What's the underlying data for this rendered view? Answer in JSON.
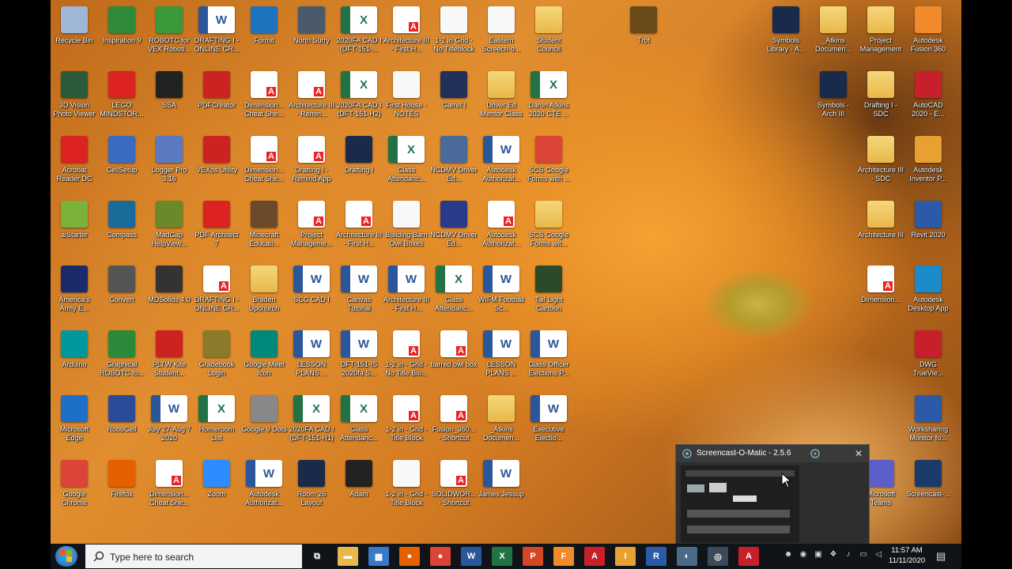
{
  "desktop_icons": [
    {
      "label": "Recycle Bin",
      "icon": "recycle-bin-icon",
      "kind": "app",
      "color": "#9fb7d6"
    },
    {
      "label": "Inspiration 9",
      "icon": "inspiration-icon",
      "kind": "app",
      "color": "#2f8a3a"
    },
    {
      "label": "ROBOTC for VEX Roboti...",
      "icon": "robotc-icon",
      "kind": "app",
      "color": "#3a9a3a"
    },
    {
      "label": "DRAFTING I - ONLINE GR...",
      "icon": "word-doc-icon",
      "kind": "word",
      "color": "#2b579a"
    },
    {
      "label": "Formit",
      "icon": "formit-icon",
      "kind": "app",
      "color": "#1e73be"
    },
    {
      "label": "North Surry",
      "icon": "school-image-icon",
      "kind": "app",
      "color": "#4a5a6a"
    },
    {
      "label": "2020FA CAD I (DFT-151-...",
      "icon": "excel-doc-icon",
      "kind": "excel",
      "color": "#217346"
    },
    {
      "label": "Architecture III - First H...",
      "icon": "pdf-doc-icon",
      "kind": "pdf",
      "color": "#e22"
    },
    {
      "label": "1-2 in Grid - No Titleblock",
      "icon": "blank-doc-icon",
      "kind": "doc",
      "color": "#fff"
    },
    {
      "label": "Eastern Screech-o...",
      "icon": "doc-icon",
      "kind": "doc",
      "color": "#fff"
    },
    {
      "label": "Student Council",
      "icon": "folder-icon",
      "kind": "folder",
      "color": "#e8b84a"
    },
    {
      "label": "Trot",
      "icon": "trot-icon",
      "kind": "app",
      "color": "#6b4a1a"
    },
    {
      "label": "3D Vision Photo Viewer",
      "icon": "3d-vision-icon",
      "kind": "app",
      "color": "#2b5a3a"
    },
    {
      "label": "LEGO MINDSTOR...",
      "icon": "lego-icon",
      "kind": "app",
      "color": "#d22"
    },
    {
      "label": "SSA",
      "icon": "ssa-icon",
      "kind": "app",
      "color": "#222"
    },
    {
      "label": "PDFCreator",
      "icon": "pdfcreator-icon",
      "kind": "app",
      "color": "#c22"
    },
    {
      "label": "Dimension... Cheat She...",
      "icon": "pdf-doc-icon",
      "kind": "pdf",
      "color": "#e22"
    },
    {
      "label": "Architecture III - Remin...",
      "icon": "pdf-doc-icon",
      "kind": "pdf",
      "color": "#e22"
    },
    {
      "label": "2020FA CAD I (DFT-151-H2)",
      "icon": "excel-doc-icon",
      "kind": "excel",
      "color": "#217346"
    },
    {
      "label": "First House - NOTES",
      "icon": "doc-icon",
      "kind": "doc",
      "color": "#fff"
    },
    {
      "label": "Garret I",
      "icon": "garret-image-icon",
      "kind": "app",
      "color": "#23305a"
    },
    {
      "label": "Driver Ed Mentor Class",
      "icon": "folder-icon",
      "kind": "folder",
      "color": "#e8b84a"
    },
    {
      "label": "Daron Atkins 2020 CTE ...",
      "icon": "excel-doc-icon",
      "kind": "excel",
      "color": "#217346"
    },
    {
      "label": "Acrobat Reader DC",
      "icon": "acrobat-icon",
      "kind": "app",
      "color": "#d22"
    },
    {
      "label": "CellSetup",
      "icon": "cellsetup-icon",
      "kind": "app",
      "color": "#3a6ac2"
    },
    {
      "label": "Logger Pro 3.16",
      "icon": "logger-pro-icon",
      "kind": "app",
      "color": "#5a7ac2"
    },
    {
      "label": "VEXos Utility",
      "icon": "vexos-icon",
      "kind": "app",
      "color": "#c22"
    },
    {
      "label": "Dimension... Cheat She...",
      "icon": "pdf-doc-icon",
      "kind": "pdf",
      "color": "#e22"
    },
    {
      "label": "Drafting I - Remind App",
      "icon": "pdf-doc-icon",
      "kind": "pdf",
      "color": "#e22"
    },
    {
      "label": "Drafting I",
      "icon": "book-icon",
      "kind": "app",
      "color": "#1a2a4a"
    },
    {
      "label": "Class Attendanc...",
      "icon": "excel-doc-icon",
      "kind": "excel",
      "color": "#217346"
    },
    {
      "label": "NCDMV Driver Ed...",
      "icon": "ncdmv-icon",
      "kind": "app",
      "color": "#4a6a9a"
    },
    {
      "label": "Autodesk Authorizat...",
      "icon": "word-doc-icon",
      "kind": "word",
      "color": "#2b579a"
    },
    {
      "label": "SCS Google Forms with ...",
      "icon": "chrome-icon",
      "kind": "app",
      "color": "#db4437"
    },
    {
      "label": "aiStarter",
      "icon": "aistarter-icon",
      "kind": "app",
      "color": "#7ab23a"
    },
    {
      "label": "Compass",
      "icon": "compass-icon",
      "kind": "app",
      "color": "#1a6a9a"
    },
    {
      "label": "MadCap HelpView...",
      "icon": "madcap-icon",
      "kind": "app",
      "color": "#6a8a2a"
    },
    {
      "label": "PDF Architect 7",
      "icon": "pdf-architect-icon",
      "kind": "app",
      "color": "#d22"
    },
    {
      "label": "Minecraft Educati...",
      "icon": "minecraft-icon",
      "kind": "app",
      "color": "#6a4a2a"
    },
    {
      "label": "Project Manageme...",
      "icon": "pdf-doc-icon",
      "kind": "pdf",
      "color": "#e22"
    },
    {
      "label": "Architecture III - First H...",
      "icon": "pdf-doc-icon",
      "kind": "pdf",
      "color": "#e22"
    },
    {
      "label": "Building Barn Owl Boxes",
      "icon": "image-doc-icon",
      "kind": "doc",
      "color": "#fff"
    },
    {
      "label": "NCDMV Driver Ed...",
      "icon": "ncdmv-icon",
      "kind": "app",
      "color": "#2a3a8a"
    },
    {
      "label": "Autodesk Authorizat...",
      "icon": "pdf-doc-icon",
      "kind": "pdf",
      "color": "#e22"
    },
    {
      "label": "SCS Google Forms wit...",
      "icon": "folder-icon",
      "kind": "folder",
      "color": "#e8b84a"
    },
    {
      "label": "America's Army E...",
      "icon": "americas-army-icon",
      "kind": "app",
      "color": "#1a2a6a"
    },
    {
      "label": "Convert",
      "icon": "convert-icon",
      "kind": "app",
      "color": "#555"
    },
    {
      "label": "MDSolids 4.0",
      "icon": "mdsolids-icon",
      "kind": "app",
      "color": "#333"
    },
    {
      "label": "DRAFTING I - ONLINE GR...",
      "icon": "pdf-doc-icon",
      "kind": "pdf",
      "color": "#e22"
    },
    {
      "label": "Braden Upchurch",
      "icon": "folder-icon",
      "kind": "folder",
      "color": "#e8b84a"
    },
    {
      "label": "SCC CAD I",
      "icon": "word-doc-icon",
      "kind": "word",
      "color": "#2b579a"
    },
    {
      "label": "Canvas Tutorial",
      "icon": "word-doc-icon",
      "kind": "word",
      "color": "#2b579a"
    },
    {
      "label": "Architecture III - First H...",
      "icon": "word-doc-icon",
      "kind": "word",
      "color": "#2b579a"
    },
    {
      "label": "Class Attendanc...",
      "icon": "excel-doc-icon",
      "kind": "excel",
      "color": "#217346"
    },
    {
      "label": "WIFM Football Sc...",
      "icon": "word-doc-icon",
      "kind": "word",
      "color": "#2b579a"
    },
    {
      "label": "Tail Light Cartoon",
      "icon": "image-icon",
      "kind": "app",
      "color": "#2a4a2a"
    },
    {
      "label": "Arduino",
      "icon": "arduino-icon",
      "kind": "app",
      "color": "#00979d"
    },
    {
      "label": "Graphical ROBOTC fo...",
      "icon": "graphical-robotc-icon",
      "kind": "app",
      "color": "#2a8a3a"
    },
    {
      "label": "PLTW Kite Student...",
      "icon": "pltw-kite-icon",
      "kind": "app",
      "color": "#c22"
    },
    {
      "label": "Gradebook Login",
      "icon": "gradebook-icon",
      "kind": "app",
      "color": "#8a7a2a"
    },
    {
      "label": "Google Meet Icon",
      "icon": "google-meet-icon",
      "kind": "app",
      "color": "#00897b"
    },
    {
      "label": "LESSON PLANS ...",
      "icon": "word-doc-icon",
      "kind": "word",
      "color": "#2b579a"
    },
    {
      "label": "DFT-151-IS 2020fa S...",
      "icon": "word-doc-icon",
      "kind": "word",
      "color": "#2b579a"
    },
    {
      "label": "1-2 in - Grid - No Title Blo...",
      "icon": "pdf-doc-icon",
      "kind": "pdf",
      "color": "#e22"
    },
    {
      "label": "barred owl box",
      "icon": "pdf-doc-icon",
      "kind": "pdf",
      "color": "#e22"
    },
    {
      "label": "LESSON PLANS ...",
      "icon": "word-doc-icon",
      "kind": "word",
      "color": "#2b579a"
    },
    {
      "label": "Class Officer Elections P...",
      "icon": "word-doc-icon",
      "kind": "word",
      "color": "#2b579a"
    },
    {
      "label": "Microsoft Edge",
      "icon": "edge-icon",
      "kind": "app",
      "color": "#1e6fc8"
    },
    {
      "label": "RoboCell",
      "icon": "robocell-icon",
      "kind": "app",
      "color": "#2a4a9a"
    },
    {
      "label": "July 27-Aug 7 2020",
      "icon": "word-doc-icon",
      "kind": "word",
      "color": "#2b579a"
    },
    {
      "label": "Homeroom List",
      "icon": "excel-doc-icon",
      "kind": "excel",
      "color": "#217346"
    },
    {
      "label": "Google 9 Dots",
      "icon": "google-dots-icon",
      "kind": "app",
      "color": "#888"
    },
    {
      "label": "2020FA CAD I (DFT-151-H1)",
      "icon": "excel-doc-icon",
      "kind": "excel",
      "color": "#217346"
    },
    {
      "label": "Class Attendanc...",
      "icon": "excel-doc-icon",
      "kind": "excel",
      "color": "#217346"
    },
    {
      "label": "1-2 in - Grid - Title Block",
      "icon": "pdf-doc-icon",
      "kind": "pdf",
      "color": "#e22"
    },
    {
      "label": "Fusion_360... - Shortcut",
      "icon": "pdf-doc-icon",
      "kind": "pdf",
      "color": "#e22"
    },
    {
      "label": "_Atkins Documen...",
      "icon": "folder-icon",
      "kind": "folder",
      "color": "#e8b84a"
    },
    {
      "label": "Executive Electio...",
      "icon": "word-doc-icon",
      "kind": "word",
      "color": "#2b579a"
    },
    {
      "label": "Google Chrome",
      "icon": "chrome-icon",
      "kind": "app",
      "color": "#db4437"
    },
    {
      "label": "Firefox",
      "icon": "firefox-icon",
      "kind": "app",
      "color": "#e66000"
    },
    {
      "label": "Dimension... Cheat She...",
      "icon": "pdf-doc-icon",
      "kind": "pdf",
      "color": "#e22"
    },
    {
      "label": "Zoom",
      "icon": "zoom-icon",
      "kind": "app",
      "color": "#2d8cff"
    },
    {
      "label": "Autodesk Authorizat...",
      "icon": "word-doc-icon",
      "kind": "word",
      "color": "#2b579a"
    },
    {
      "label": "Room 26 Layout",
      "icon": "room-layout-icon",
      "kind": "app",
      "color": "#1a2a4a"
    },
    {
      "label": "Adam",
      "icon": "adam-icon",
      "kind": "app",
      "color": "#222"
    },
    {
      "label": "1-2 in - Grid - Title Block",
      "icon": "blank-doc-icon",
      "kind": "doc",
      "color": "#fff"
    },
    {
      "label": "SOLIDWOR... - Shortcut",
      "icon": "pdf-doc-icon",
      "kind": "pdf",
      "color": "#e22"
    },
    {
      "label": "James Jessup",
      "icon": "word-doc-icon",
      "kind": "word",
      "color": "#2b579a"
    },
    {
      "label": "Symbols Library - A...",
      "icon": "book-icon",
      "kind": "app",
      "color": "#1a2a4a"
    },
    {
      "label": "_Atkins Documen...",
      "icon": "folder-icon",
      "kind": "folder",
      "color": "#e8b84a"
    },
    {
      "label": "Project Management",
      "icon": "folder-icon",
      "kind": "folder",
      "color": "#e8b84a"
    },
    {
      "label": "Autodesk Fusion 360",
      "icon": "fusion360-icon",
      "kind": "app",
      "color": "#f08a2a"
    },
    {
      "label": "Symbols - Arch III",
      "icon": "book-icon",
      "kind": "app",
      "color": "#1a2a4a"
    },
    {
      "label": "Drafting I - SDC",
      "icon": "folder-icon",
      "kind": "folder",
      "color": "#e8b84a"
    },
    {
      "label": "AutoCAD 2020 - E...",
      "icon": "autocad-icon",
      "kind": "app",
      "color": "#c8202a"
    },
    {
      "label": "Architecture III - SDC",
      "icon": "folder-icon",
      "kind": "folder",
      "color": "#e8b84a"
    },
    {
      "label": "Autodesk Inventor P...",
      "icon": "inventor-icon",
      "kind": "app",
      "color": "#e8a030"
    },
    {
      "label": "Architecture III",
      "icon": "folder-icon",
      "kind": "folder",
      "color": "#e8b84a"
    },
    {
      "label": "Revit 2020",
      "icon": "revit-icon",
      "kind": "app",
      "color": "#2a5aa8"
    },
    {
      "label": "Dimension...",
      "icon": "pdf-doc-icon",
      "kind": "pdf",
      "color": "#e22"
    },
    {
      "label": "Autodesk Desktop App",
      "icon": "autodesk-desktop-icon",
      "kind": "app",
      "color": "#1a8acb"
    },
    {
      "label": "DWG TrueVie...",
      "icon": "dwg-trueview-icon",
      "kind": "app",
      "color": "#c8202a"
    },
    {
      "label": "Worksharing Monitor fo...",
      "icon": "worksharing-icon",
      "kind": "app",
      "color": "#2a5aa8"
    },
    {
      "label": "Microsoft Teams",
      "icon": "teams-icon",
      "kind": "app",
      "color": "#5b5fc7"
    },
    {
      "label": "Screencast-...",
      "icon": "screencast-icon",
      "kind": "app",
      "color": "#1a3a6a"
    }
  ],
  "screencast_window": {
    "title": "Screencast-O-Matic - 2.5.6",
    "close_label": "✕"
  },
  "taskbar": {
    "search_placeholder": "Type here to search",
    "time": "11:57 AM",
    "date": "11/11/2020",
    "apps": [
      {
        "name": "task-view-icon",
        "letter": "⧉",
        "color": "#101418"
      },
      {
        "name": "file-explorer-icon",
        "letter": "▬",
        "color": "#e8b84a"
      },
      {
        "name": "calculator-icon",
        "letter": "▦",
        "color": "#3a78c8"
      },
      {
        "name": "firefox-icon",
        "letter": "●",
        "color": "#e66000"
      },
      {
        "name": "chrome-icon",
        "letter": "●",
        "color": "#db4437"
      },
      {
        "name": "word-icon",
        "letter": "W",
        "color": "#2b579a"
      },
      {
        "name": "excel-icon",
        "letter": "X",
        "color": "#217346"
      },
      {
        "name": "powerpoint-icon",
        "letter": "P",
        "color": "#d24726"
      },
      {
        "name": "fusion360-icon",
        "letter": "F",
        "color": "#f08a2a"
      },
      {
        "name": "autocad-icon",
        "letter": "A",
        "color": "#c8202a"
      },
      {
        "name": "inventor-icon",
        "letter": "I",
        "color": "#e8a030"
      },
      {
        "name": "revit-icon",
        "letter": "R",
        "color": "#2a5aa8"
      },
      {
        "name": "photos-icon",
        "letter": "◐",
        "color": "#4a6a8a"
      },
      {
        "name": "screencast-icon",
        "letter": "◎",
        "color": "#3a4a5a"
      },
      {
        "name": "acrobat-icon",
        "letter": "A",
        "color": "#c8202a"
      }
    ],
    "tray": [
      {
        "name": "teams-tray-icon",
        "glyph": "☻"
      },
      {
        "name": "recorder-tray-icon",
        "glyph": "◉"
      },
      {
        "name": "app-tray-icon",
        "glyph": "▣"
      },
      {
        "name": "dropbox-tray-icon",
        "glyph": "❖"
      },
      {
        "name": "mic-tray-icon",
        "glyph": "♪"
      },
      {
        "name": "network-tray-icon",
        "glyph": "▭"
      },
      {
        "name": "volume-tray-icon",
        "glyph": "◁"
      }
    ],
    "notification_glyph": "▤"
  }
}
